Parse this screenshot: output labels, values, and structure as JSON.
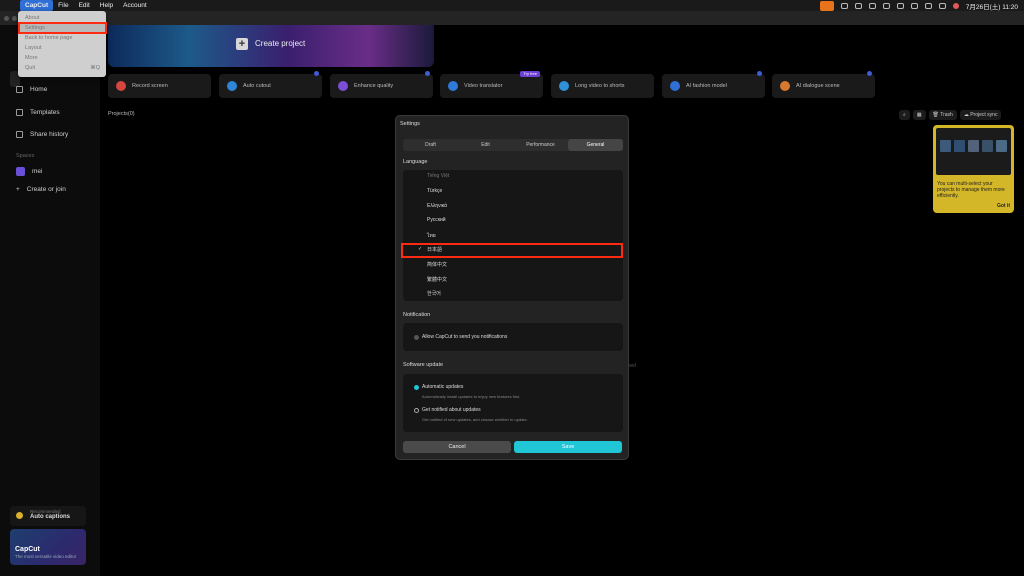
{
  "menubar": {
    "app": "CapCut",
    "items": [
      "File",
      "Edit",
      "Help",
      "Account"
    ],
    "clock": "7月26日(土) 11:20",
    "rec_color": "#e8731b"
  },
  "app_menu": {
    "items": [
      "About",
      "Settings",
      "Back to home page",
      "Layout",
      "More",
      "Quit"
    ],
    "quit_shortcut": "⌘Q",
    "highlighted": "Settings"
  },
  "sidebar": {
    "items": [
      "Home",
      "Templates",
      "Share history"
    ],
    "spaces_label": "Spaces",
    "space_name": "mei",
    "create_join": "Create or join",
    "recommended_label": "Recommended",
    "auto_captions": "Auto captions",
    "promo_title": "CapCut",
    "promo_sub": "The most versatile video editor"
  },
  "banner": {
    "label": "Create project"
  },
  "tools": [
    {
      "label": "Record screen",
      "color": "#d6453e"
    },
    {
      "label": "Auto cutout",
      "color": "#2f86d8"
    },
    {
      "label": "Enhance quality",
      "color": "#7a4fd6"
    },
    {
      "label": "Video translator",
      "color": "#2f7ad8"
    },
    {
      "label": "Long video to shorts",
      "color": "#2f8fd8"
    },
    {
      "label": "AI fashion model",
      "color": "#2f6fd6"
    },
    {
      "label": "AI dialogue scene",
      "color": "#d6782f"
    }
  ],
  "tool_free_tag": "Try free",
  "projects_label": "Projects(0)",
  "toolbar": {
    "trash": "Trash",
    "project_sync": "Project sync"
  },
  "tipcard": {
    "text": "You can multi-select your projects to manage them more efficiently.",
    "action": "Got it"
  },
  "bg_fragment": "iched",
  "settings": {
    "title": "Settings",
    "tabs": [
      "Draft",
      "Edit",
      "Performance",
      "General"
    ],
    "active_tab": "General",
    "language_heading": "Language",
    "languages": [
      "Tiếng Việt",
      "Türkçe",
      "Ελληνικά",
      "Русский",
      "ไทย",
      "日本語",
      "简体中文",
      "繁體中文",
      "한국어"
    ],
    "selected_language": "日本語",
    "notification_heading": "Notification",
    "notification_option": "Allow CapCut to send you notifications",
    "update_heading": "Software update",
    "auto_update": "Automatic updates",
    "auto_update_desc": "Automatically install updates to enjoy new features first.",
    "notify_update": "Get notified about updates",
    "notify_update_desc": "Get notified of new updates, and choose whether to update.",
    "cancel": "Cancel",
    "save": "Save",
    "accent": "#20c6d6"
  }
}
